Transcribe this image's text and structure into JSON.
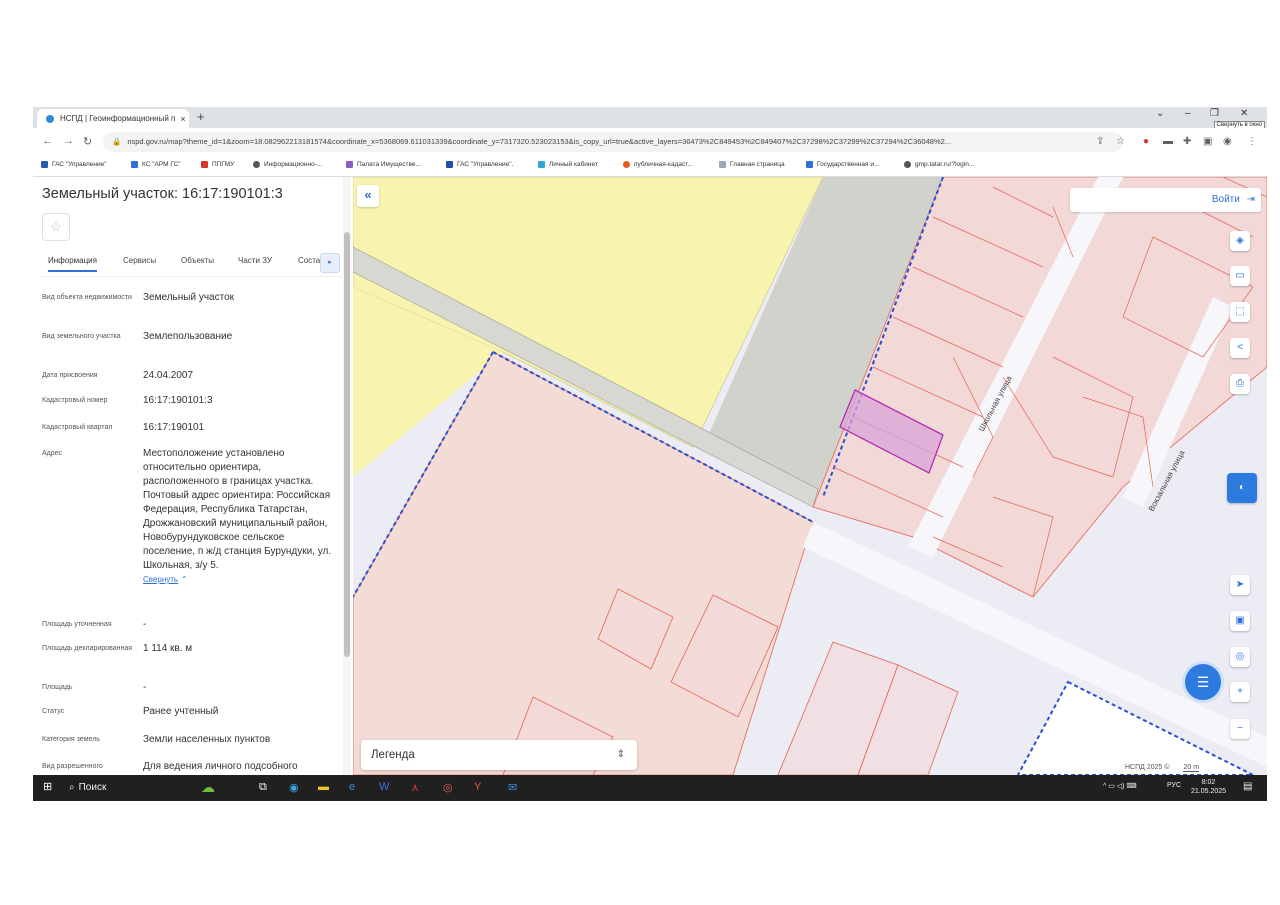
{
  "browser": {
    "tab_title": "НСПД | Геоинформационный п",
    "tab_close": "×",
    "new_tab": "+",
    "tooltip": "Свернуть в окно",
    "url": "nspd.gov.ru/map?theme_id=1&zoom=18.082962213181574&coordinate_x=5368069.611031339&coordinate_y=7317320.523023153&is_copy_url=true&active_layers=36473%2C849453%2C849407%2C37298%2C37299%2C37294%2C36048%2...",
    "bookmarks": [
      "ГАС \"Управление\"",
      "КС \"АРМ ГС\"",
      "ППГМУ",
      "Информационно-...",
      "Палата Имуществе...",
      "ГАС \"Управление\".",
      "Личный кабинет",
      "публичная-кадаст...",
      "Главная страница",
      "Государственная и...",
      "gmp.tatar.ru/?login..."
    ]
  },
  "panel": {
    "title": "Земельный участок: 16:17:190101:3",
    "tabs": [
      "Информация",
      "Сервисы",
      "Объекты",
      "Части ЗУ",
      "Соста"
    ],
    "fields": [
      {
        "label": "Вид объекта недвижимости",
        "value": "Земельный участок"
      },
      {
        "label": "Вид земельного участка",
        "value": "Землепользование"
      },
      {
        "label": "Дата присвоения",
        "value": "24.04.2007"
      },
      {
        "label": "Кадастровый номер",
        "value": "16:17:190101:3"
      },
      {
        "label": "Кадастровый квартал",
        "value": "16:17:190101"
      },
      {
        "label": "Адрес",
        "value": "Местоположение установлено относительно ориентира, расположенного в границах участка. Почтовый адрес ориентира: Российская Федерация, Республика Татарстан, Дрожжановский муниципальный район, Новобурундуковское сельское поселение, п ж/д станция Бурундуки, ул. Школьная, з/у 5."
      },
      {
        "label": "Площадь уточненная",
        "value": "-"
      },
      {
        "label": "Площадь декларированная",
        "value": "1 114 кв. м"
      },
      {
        "label": "Площадь",
        "value": "-"
      },
      {
        "label": "Статус",
        "value": "Ранее учтенный"
      },
      {
        "label": "Категория земель",
        "value": "Земли населенных пунктов"
      },
      {
        "label": "Вид разрешенного",
        "value": "Для ведения личного подсобного"
      }
    ],
    "collapse_link": "Свернуть"
  },
  "map": {
    "login": "Войти",
    "legend": "Легенда",
    "street_1": "Школьная улица",
    "street_2": "Вокзальная улица",
    "attribution": "НСПД 2025 ©",
    "scale": "20 m"
  },
  "taskbar": {
    "search": "Поиск",
    "lang": "РУС",
    "time": "8:02",
    "date": "21.05.2025"
  },
  "colors": {
    "accent": "#2e6fd8",
    "parcel_fill": "#f4d8d8",
    "parcel_stroke": "#e8614f",
    "selected": "#b22fb2",
    "yellow_zone": "#f8f4b0"
  }
}
